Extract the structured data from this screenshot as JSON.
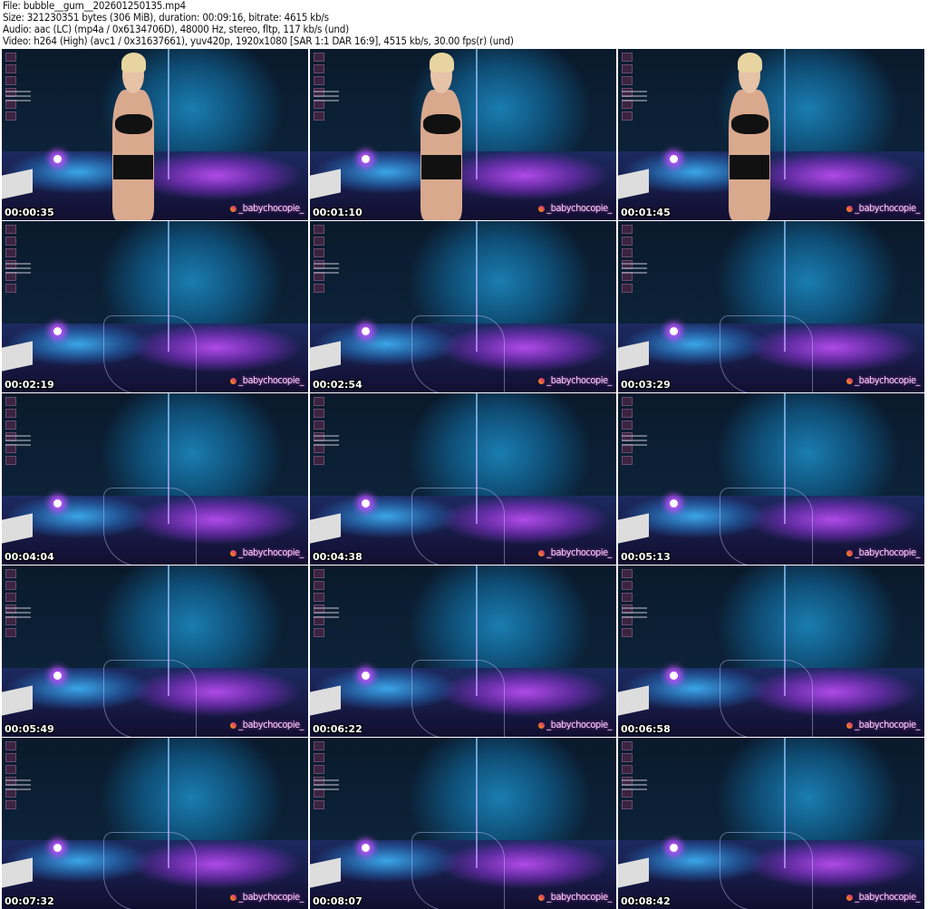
{
  "header": {
    "file": "File: bubble__gum__202601250135.mp4",
    "size": "Size: 321230351 bytes (306 MiB), duration: 00:09:16, bitrate: 4615 kb/s",
    "audio": "Audio: aac (LC) (mp4a / 0x6134706D), 48000 Hz, stereo, fltp, 117 kb/s (und)",
    "video": "Video: h264 (High) (avc1 / 0x31637661), yuv420p, 1920x1080 [SAR 1:1 DAR 16:9], 4515 kb/s, 30.00 fps(r) (und)"
  },
  "watermark": "_babychocopie_",
  "thumbnails": [
    {
      "time": "00:00:35",
      "person": true
    },
    {
      "time": "00:01:10",
      "person": true
    },
    {
      "time": "00:01:45",
      "person": true
    },
    {
      "time": "00:02:19",
      "person": false
    },
    {
      "time": "00:02:54",
      "person": false
    },
    {
      "time": "00:03:29",
      "person": false
    },
    {
      "time": "00:04:04",
      "person": false
    },
    {
      "time": "00:04:38",
      "person": false
    },
    {
      "time": "00:05:13",
      "person": false
    },
    {
      "time": "00:05:49",
      "person": false
    },
    {
      "time": "00:06:22",
      "person": false
    },
    {
      "time": "00:06:58",
      "person": false
    },
    {
      "time": "00:07:32",
      "person": false
    },
    {
      "time": "00:08:07",
      "person": false
    },
    {
      "time": "00:08:42",
      "person": false
    }
  ]
}
